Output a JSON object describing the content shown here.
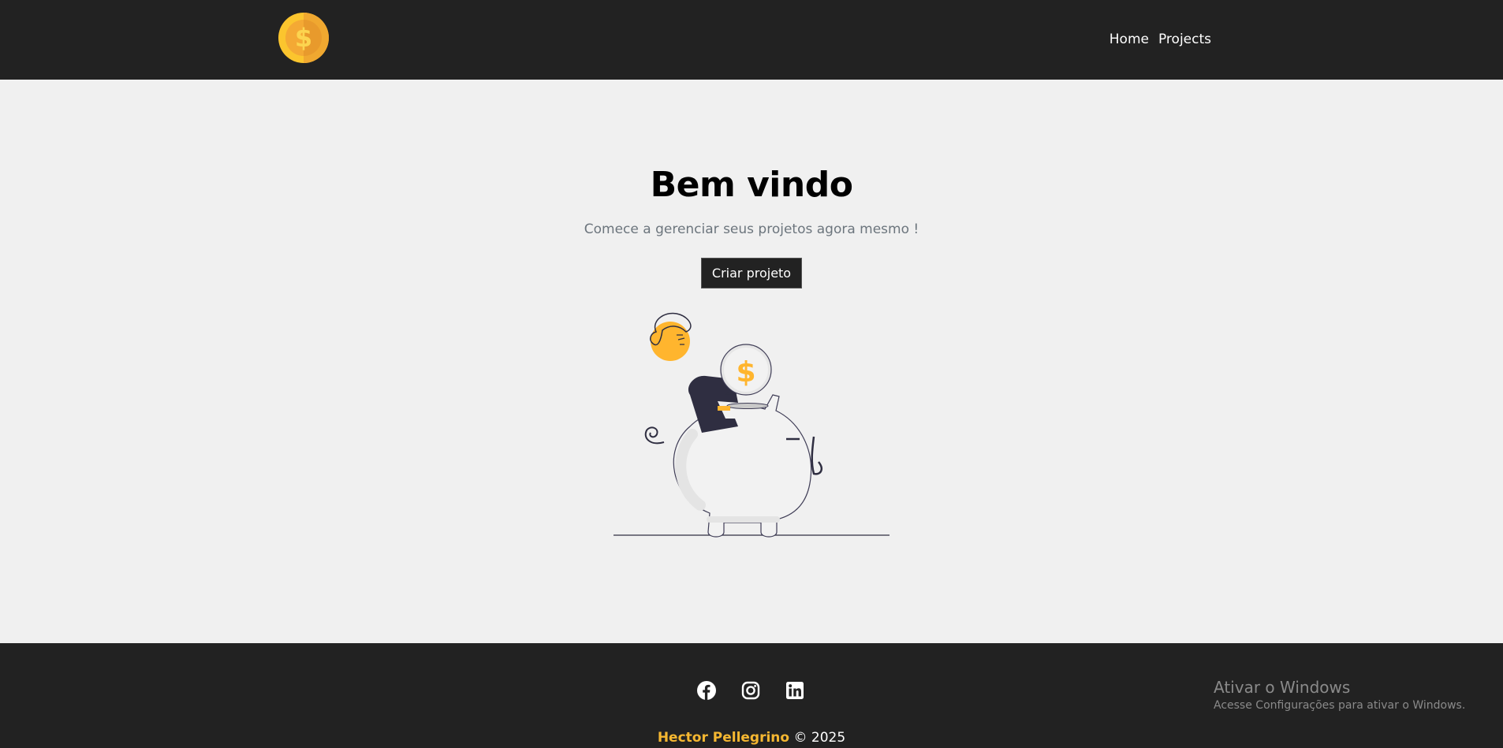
{
  "header": {
    "nav": [
      {
        "label": "Home"
      },
      {
        "label": "Projects"
      }
    ]
  },
  "hero": {
    "title": "Bem vindo",
    "subtitle": "Comece a gerenciar seus projetos agora mesmo !",
    "cta_label": "Criar projeto",
    "coin_symbol": "$"
  },
  "footer": {
    "socials": [
      "facebook-icon",
      "instagram-icon",
      "linkedin-icon"
    ],
    "author": "Hector Pellegrino",
    "copyright": "© 2025"
  },
  "os_overlay": {
    "title": "Ativar o Windows",
    "message": "Acesse Configurações para ativar o Windows."
  },
  "colors": {
    "bar": "#222222",
    "background": "#f0f0f0",
    "accent": "#f5b731"
  }
}
